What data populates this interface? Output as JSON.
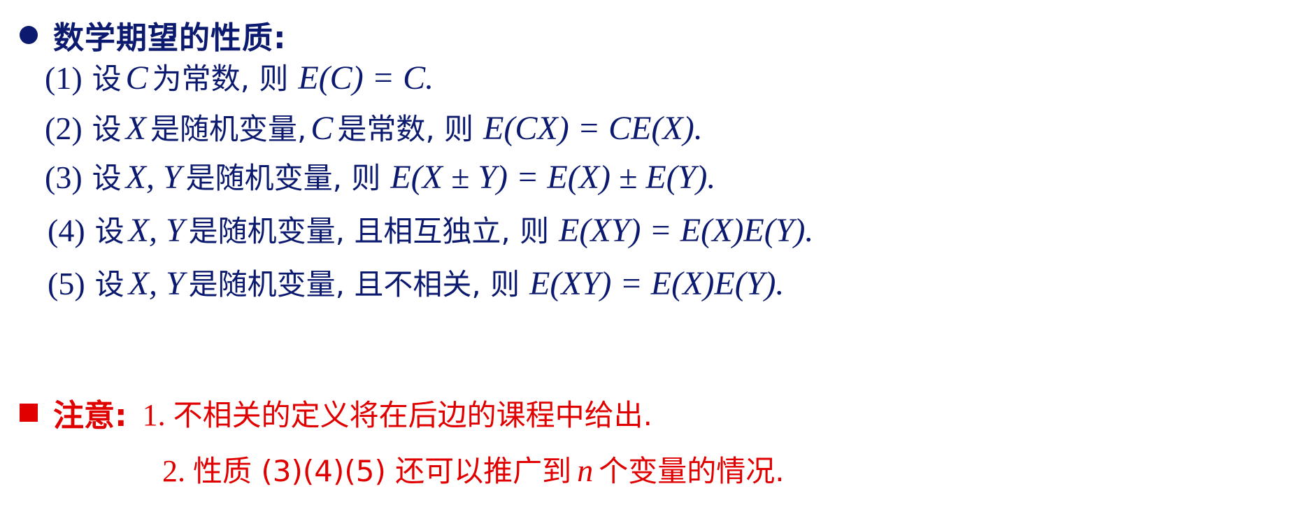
{
  "heading": "数学期望的性质:",
  "properties": [
    {
      "num": "(1)",
      "pre": "设",
      "v1": "C",
      "text": "为常数, 则",
      "math": "E(C) = C."
    },
    {
      "num": "(2)",
      "pre": "设",
      "v1": "X",
      "text": "是随机变量,",
      "v2": "C",
      "text2": "是常数, 则",
      "math": "E(CX) = CE(X)."
    },
    {
      "num": "(3)",
      "pre": "设",
      "v1": "X, Y",
      "text": "是随机变量, 则",
      "math": "E(X ± Y) = E(X) ± E(Y)."
    },
    {
      "num": "(4)",
      "pre": "设",
      "v1": "X, Y",
      "text": "是随机变量, 且相互独立, 则",
      "math": "E(XY) = E(X)E(Y)."
    },
    {
      "num": "(5)",
      "pre": "设",
      "v1": "X, Y",
      "text": "是随机变量, 且不相关, 则",
      "math": "E(XY) = E(X)E(Y)."
    }
  ],
  "note": {
    "label": "注意:",
    "line1_num": "1.",
    "line1_text": "不相关的定义将在后边的课程中给出.",
    "line2_num": "2.",
    "line2_pre": "性质 (3)(4)(5) 还可以推广到",
    "line2_var": "n",
    "line2_post": "个变量的情况."
  },
  "colors": {
    "primary": "#0b1a6e",
    "accent": "#e00000"
  }
}
